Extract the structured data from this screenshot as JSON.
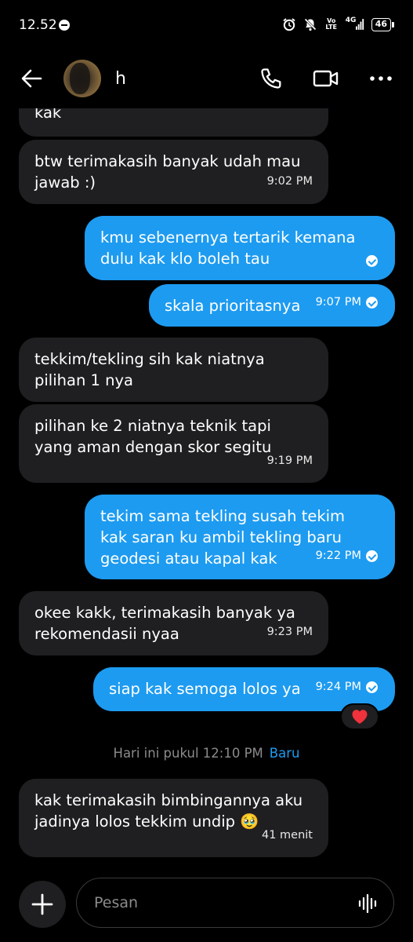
{
  "status_bar": {
    "time": "12.52",
    "network": "4G",
    "volte": "Vo LTE",
    "battery": "46"
  },
  "header": {
    "contact_name": "h"
  },
  "messages": [
    {
      "text_lines": [
        "kak"
      ]
    },
    {
      "text_lines": [
        "btw terimakasih banyak udah mau",
        "jawab :)"
      ],
      "time": "9:02 PM"
    },
    {
      "text_lines": [
        "kmu sebenernya tertarik kemana",
        "dulu kak klo boleh tau"
      ]
    },
    {
      "text_lines": [
        "skala prioritasnya"
      ],
      "time": "9:07 PM"
    },
    {
      "text_lines": [
        "tekkim/tekling sih kak niatnya",
        "pilihan 1 nya"
      ]
    },
    {
      "text_lines": [
        "pilihan ke 2 niatnya teknik tapi",
        "yang aman dengan skor segitu"
      ],
      "time": "9:19 PM"
    },
    {
      "text_lines": [
        "tekim sama tekling susah tekim",
        "kak saran ku ambil tekling baru",
        "geodesi atau kapal kak"
      ],
      "time": "9:22 PM"
    },
    {
      "text_lines": [
        "okee kakk, terimakasih banyak ya",
        "rekomendasii nyaa"
      ],
      "time": "9:23 PM"
    },
    {
      "text_lines": [
        "siap kak semoga lolos ya"
      ],
      "time": "9:24 PM"
    },
    {
      "text_lines": [
        "kak terimakasih bimbingannya aku",
        "jadinya lolos tekkim undip 🥹"
      ],
      "time": "41 menit"
    }
  ],
  "reaction": {
    "emoji": "heart-icon"
  },
  "divider": {
    "label": "Hari ini pukul 12:10 PM",
    "new_label": "Baru"
  },
  "composer": {
    "placeholder": "Pesan"
  },
  "colors": {
    "outgoing": "#1d9bf0",
    "incoming": "#1f1f21",
    "background": "#000000"
  }
}
